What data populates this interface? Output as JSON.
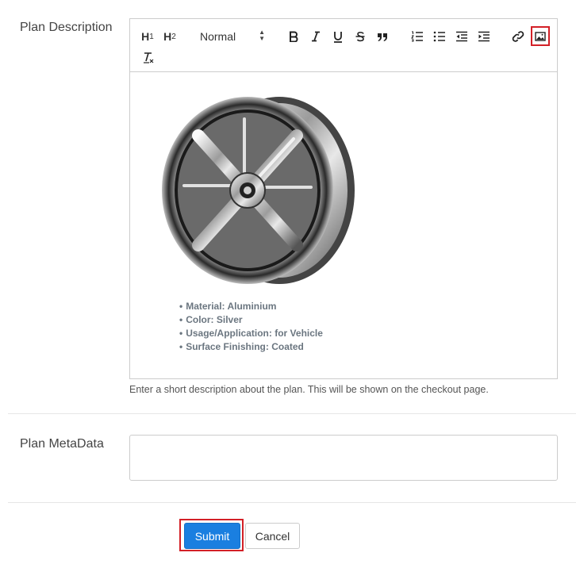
{
  "plan_description": {
    "label": "Plan Description",
    "editor": {
      "toolbar": {
        "h1": "H",
        "h1_sub": "1",
        "h2": "H",
        "h2_sub": "2",
        "font_size": "Normal"
      },
      "content": {
        "image_alt": "chrome-wheel",
        "bullets": [
          "Material: Aluminium",
          "Color: Silver",
          "Usage/Application: for Vehicle",
          "Surface Finishing: Coated"
        ]
      }
    },
    "help_text": "Enter a short description about the plan. This will be shown on the checkout page."
  },
  "plan_metadata": {
    "label": "Plan MetaData",
    "value": ""
  },
  "actions": {
    "submit": "Submit",
    "cancel": "Cancel"
  },
  "colors": {
    "primary": "#1a7fe0",
    "highlight": "#d32027"
  }
}
